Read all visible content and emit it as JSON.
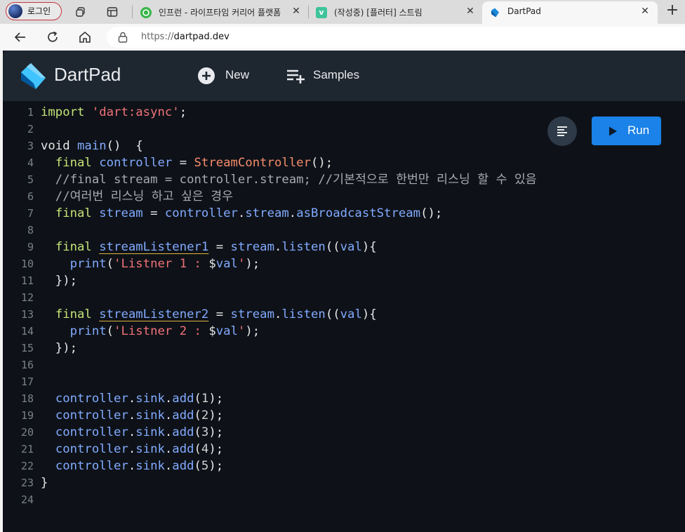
{
  "browser": {
    "profile_label": "로그인",
    "tabs": [
      {
        "title": "인프런 - 라이프타임 커리어 플랫폼",
        "favicon_color": "#3ab54a"
      },
      {
        "title": "(작성중) [플러터] 스트림",
        "favicon_color": "#3ec39a",
        "favicon_letter": "v"
      },
      {
        "title": "DartPad",
        "favicon_color": "#1b88d8"
      }
    ],
    "close_glyph": "✕",
    "newtab_glyph": "+",
    "url_scheme": "https://",
    "url_host": "dartpad.dev"
  },
  "app": {
    "title": "DartPad",
    "new_label": "New",
    "samples_label": "Samples",
    "run_label": "Run"
  },
  "colors": {
    "keyword": "#c5e478",
    "string": "#f07178",
    "class": "#f78c6c",
    "identifier": "#82aaff",
    "comment": "#a8aab0",
    "run_button": "#1a82e8",
    "header_bg": "#1e2630",
    "editor_bg": "#0e1218"
  },
  "code_lines": [
    {
      "n": "1",
      "tokens": [
        [
          "kw",
          "import "
        ],
        [
          "str",
          "'dart:async'"
        ],
        [
          "plain",
          ";"
        ]
      ]
    },
    {
      "n": "2",
      "tokens": []
    },
    {
      "n": "3",
      "tokens": [
        [
          "plain",
          "void "
        ],
        [
          "fn",
          "main"
        ],
        [
          "plain",
          "()  {"
        ]
      ]
    },
    {
      "n": "4",
      "tokens": [
        [
          "plain",
          "  "
        ],
        [
          "kw",
          "final "
        ],
        [
          "fn",
          "controller"
        ],
        [
          "plain",
          " = "
        ],
        [
          "cls",
          "StreamController"
        ],
        [
          "plain",
          "();"
        ]
      ]
    },
    {
      "n": "5",
      "tokens": [
        [
          "cmt",
          "  //final stream = controller.stream; //기본적으로 한번만 리스닝 할 수 있음"
        ]
      ]
    },
    {
      "n": "6",
      "tokens": [
        [
          "cmt",
          "  //여러번 리스닝 하고 싶은 경우"
        ]
      ]
    },
    {
      "n": "7",
      "tokens": [
        [
          "plain",
          "  "
        ],
        [
          "kw",
          "final "
        ],
        [
          "fn",
          "stream"
        ],
        [
          "plain",
          " = "
        ],
        [
          "fn",
          "controller"
        ],
        [
          "plain",
          "."
        ],
        [
          "fn",
          "stream"
        ],
        [
          "plain",
          "."
        ],
        [
          "fn",
          "asBroadcastStream"
        ],
        [
          "plain",
          "();"
        ]
      ]
    },
    {
      "n": "8",
      "tokens": []
    },
    {
      "n": "9",
      "tokens": [
        [
          "plain",
          "  "
        ],
        [
          "kw",
          "final "
        ],
        [
          "warn",
          "streamListener1"
        ],
        [
          "plain",
          " = "
        ],
        [
          "fn",
          "stream"
        ],
        [
          "plain",
          "."
        ],
        [
          "fn",
          "listen"
        ],
        [
          "plain",
          "(("
        ],
        [
          "fn",
          "val"
        ],
        [
          "plain",
          "){"
        ]
      ]
    },
    {
      "n": "10",
      "tokens": [
        [
          "plain",
          "    "
        ],
        [
          "fn",
          "print"
        ],
        [
          "plain",
          "("
        ],
        [
          "str",
          "'Listner 1 : "
        ],
        [
          "plain",
          "$"
        ],
        [
          "fn",
          "val"
        ],
        [
          "str",
          "'"
        ],
        [
          "plain",
          ");"
        ]
      ]
    },
    {
      "n": "11",
      "tokens": [
        [
          "plain",
          "  });"
        ]
      ]
    },
    {
      "n": "12",
      "tokens": []
    },
    {
      "n": "13",
      "tokens": [
        [
          "plain",
          "  "
        ],
        [
          "kw",
          "final "
        ],
        [
          "warn",
          "streamListener2"
        ],
        [
          "plain",
          " = "
        ],
        [
          "fn",
          "stream"
        ],
        [
          "plain",
          "."
        ],
        [
          "fn",
          "listen"
        ],
        [
          "plain",
          "(("
        ],
        [
          "fn",
          "val"
        ],
        [
          "plain",
          "){"
        ]
      ]
    },
    {
      "n": "14",
      "tokens": [
        [
          "plain",
          "    "
        ],
        [
          "fn",
          "print"
        ],
        [
          "plain",
          "("
        ],
        [
          "str",
          "'Listner 2 : "
        ],
        [
          "plain",
          "$"
        ],
        [
          "fn",
          "val"
        ],
        [
          "str",
          "'"
        ],
        [
          "plain",
          ");"
        ]
      ]
    },
    {
      "n": "15",
      "tokens": [
        [
          "plain",
          "  });"
        ]
      ]
    },
    {
      "n": "16",
      "tokens": []
    },
    {
      "n": "17",
      "tokens": []
    },
    {
      "n": "18",
      "tokens": [
        [
          "plain",
          "  "
        ],
        [
          "fn",
          "controller"
        ],
        [
          "plain",
          "."
        ],
        [
          "fn",
          "sink"
        ],
        [
          "plain",
          "."
        ],
        [
          "fn",
          "add"
        ],
        [
          "plain",
          "("
        ],
        [
          "num",
          "1"
        ],
        [
          "plain",
          ");"
        ]
      ]
    },
    {
      "n": "19",
      "tokens": [
        [
          "plain",
          "  "
        ],
        [
          "fn",
          "controller"
        ],
        [
          "plain",
          "."
        ],
        [
          "fn",
          "sink"
        ],
        [
          "plain",
          "."
        ],
        [
          "fn",
          "add"
        ],
        [
          "plain",
          "("
        ],
        [
          "num",
          "2"
        ],
        [
          "plain",
          ");"
        ]
      ]
    },
    {
      "n": "20",
      "tokens": [
        [
          "plain",
          "  "
        ],
        [
          "fn",
          "controller"
        ],
        [
          "plain",
          "."
        ],
        [
          "fn",
          "sink"
        ],
        [
          "plain",
          "."
        ],
        [
          "fn",
          "add"
        ],
        [
          "plain",
          "("
        ],
        [
          "num",
          "3"
        ],
        [
          "plain",
          ");"
        ]
      ]
    },
    {
      "n": "21",
      "tokens": [
        [
          "plain",
          "  "
        ],
        [
          "fn",
          "controller"
        ],
        [
          "plain",
          "."
        ],
        [
          "fn",
          "sink"
        ],
        [
          "plain",
          "."
        ],
        [
          "fn",
          "add"
        ],
        [
          "plain",
          "("
        ],
        [
          "num",
          "4"
        ],
        [
          "plain",
          ");"
        ]
      ]
    },
    {
      "n": "22",
      "tokens": [
        [
          "plain",
          "  "
        ],
        [
          "fn",
          "controller"
        ],
        [
          "plain",
          "."
        ],
        [
          "fn",
          "sink"
        ],
        [
          "plain",
          "."
        ],
        [
          "fn",
          "add"
        ],
        [
          "plain",
          "("
        ],
        [
          "num",
          "5"
        ],
        [
          "plain",
          ");"
        ]
      ]
    },
    {
      "n": "23",
      "tokens": [
        [
          "plain",
          "}"
        ]
      ]
    },
    {
      "n": "24",
      "tokens": []
    }
  ],
  "icons": {
    "back": "arrow-left-icon",
    "reload": "reload-icon",
    "home": "home-icon",
    "lock": "lock-icon",
    "new": "plus-circle-icon",
    "samples": "playlist-add-icon",
    "format": "format-align-icon",
    "run": "play-icon"
  }
}
